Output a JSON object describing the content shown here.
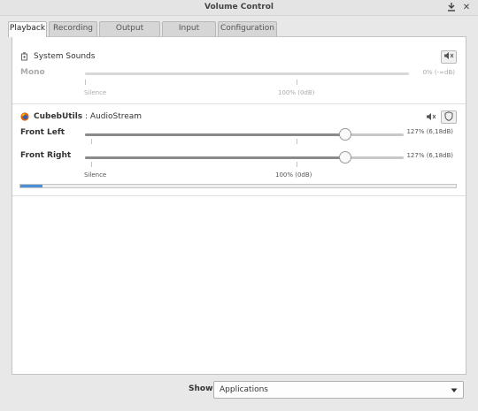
{
  "window": {
    "title": "Volume Control"
  },
  "tabs": [
    "Playback",
    "Recording",
    "Output Devices",
    "Input Devices",
    "Configuration"
  ],
  "streams": [
    {
      "name": "System Sounds",
      "channel": "Mono",
      "value": "0% (-∞dB)",
      "level": 0.0,
      "marks": {
        "silence": "Silence",
        "base": "100% (0dB)"
      }
    },
    {
      "app": "CubebUtils",
      "stream": "AudioStream",
      "channels": [
        {
          "label": "Front Left",
          "value": "127% (6,18dB)",
          "level": 0.85
        },
        {
          "label": "Front Right",
          "value": "127% (6,18dB)",
          "level": 0.85
        }
      ],
      "marks": {
        "silence": "Silence",
        "base": "100% (0dB)"
      },
      "peak": 0.05
    }
  ],
  "footer": {
    "show_label": "Show:",
    "selected": "Applications"
  }
}
